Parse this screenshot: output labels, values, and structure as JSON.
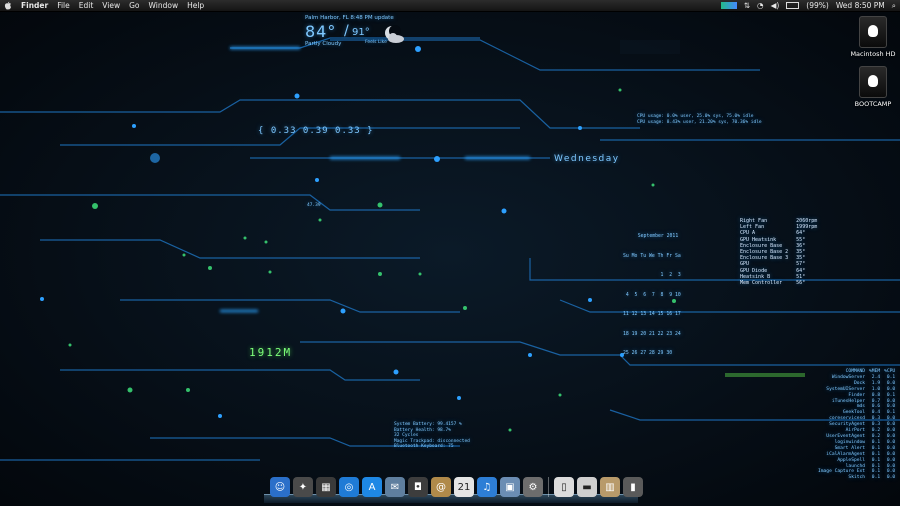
{
  "menubar": {
    "app": "Finder",
    "menus": [
      "File",
      "Edit",
      "View",
      "Go",
      "Window",
      "Help"
    ],
    "battery": "(99%)",
    "clock": "Wed 8:50 PM",
    "icons": [
      "apple-icon",
      "activity-icon",
      "network-icon",
      "wifi-icon",
      "volume-icon",
      "battery-icon",
      "search-icon"
    ]
  },
  "desktop": {
    "drives": [
      {
        "label": "Macintosh HD"
      },
      {
        "label": "BOOTCAMP"
      }
    ]
  },
  "weather": {
    "location": "Palm Harbor, FL 8:48 PM update",
    "temp": "84°",
    "high": "91°",
    "feels": "Feels Like",
    "condition": "Partly Cloudy"
  },
  "load": "{ 0.33 0.39 0.33 }",
  "day": "Wednesday",
  "small_label": "47.39",
  "memory": "1912M",
  "cpu": [
    "CPU usage: 0.0% user, 25.0% sys, 75.0% idle",
    "CPU usage: 8.43% user, 21.20% sys, 70.36% idle"
  ],
  "calendar": {
    "title": "September 2011",
    "lines": [
      "Su Mo Tu We Th Fr Sa",
      "             1  2  3",
      " 4  5  6  7  8  9 10",
      "11 12 13 14 15 16 17",
      "18 19 20 21 22 23 24",
      "25 26 27 28 29 30"
    ]
  },
  "sensors": [
    [
      "Right Fan",
      "2060rpm"
    ],
    [
      "Left Fan",
      "1999rpm"
    ],
    [
      "CPU A",
      "64°"
    ],
    [
      "GPU Heatsink",
      "55°"
    ],
    [
      "Enclosure Base",
      "36°"
    ],
    [
      "Enclosure Base 2",
      "35°"
    ],
    [
      "Enclosure Base 3",
      "35°"
    ],
    [
      "GPU",
      "57°"
    ],
    [
      "GPU Diode",
      "64°"
    ],
    [
      "Heatsink B",
      "51°"
    ],
    [
      "Mem Controller",
      "56°"
    ]
  ],
  "battery": [
    "System Battery: 99.4157 %",
    "Battery Health: 98.7%",
    "32 Cycles",
    "Magic Trackpad: disconnected",
    "Bluetooth Keyboard: 75"
  ],
  "processes": {
    "header": [
      "COMMAND",
      "%MEM",
      "%CPU"
    ],
    "rows": [
      [
        "WindowServer",
        "2.4",
        "0.1"
      ],
      [
        "Dock",
        "1.9",
        "0.0"
      ],
      [
        "SystemUIServer",
        "1.0",
        "0.0"
      ],
      [
        "Finder",
        "0.8",
        "0.1"
      ],
      [
        "iTunesHelper",
        "0.7",
        "0.0"
      ],
      [
        "mds",
        "0.6",
        "0.0"
      ],
      [
        "GeekTool",
        "0.4",
        "0.1"
      ],
      [
        "coreservicesd",
        "0.3",
        "0.0"
      ],
      [
        "SecurityAgent",
        "0.3",
        "0.0"
      ],
      [
        "AirPort",
        "0.2",
        "0.0"
      ],
      [
        "UserEventAgent",
        "0.2",
        "0.0"
      ],
      [
        "loginwindow",
        "0.1",
        "0.0"
      ],
      [
        "Smart Alert",
        "0.1",
        "0.0"
      ],
      [
        "iCalAlarmAgent",
        "0.1",
        "0.0"
      ],
      [
        "AppleSpell",
        "0.1",
        "0.0"
      ],
      [
        "launchd",
        "0.1",
        "0.0"
      ],
      [
        "Image Capture Ext",
        "0.1",
        "0.0"
      ],
      [
        "Skitch",
        "0.1",
        "0.0"
      ]
    ]
  },
  "dock": {
    "items": [
      {
        "name": "finder-icon",
        "glyph": "☺",
        "color": "#2b6fc9"
      },
      {
        "name": "launchpad-icon",
        "glyph": "✦",
        "color": "#4a4a4a"
      },
      {
        "name": "mission-control-icon",
        "glyph": "▦",
        "color": "#3a3a3a"
      },
      {
        "name": "safari-icon",
        "glyph": "◎",
        "color": "#1f7bd6"
      },
      {
        "name": "app-store-icon",
        "glyph": "A",
        "color": "#1e88e5"
      },
      {
        "name": "mail-icon",
        "glyph": "✉",
        "color": "#5f7f9f"
      },
      {
        "name": "facetime-icon",
        "glyph": "◘",
        "color": "#3d3d3d"
      },
      {
        "name": "address-book-icon",
        "glyph": "@",
        "color": "#b08a4a"
      },
      {
        "name": "ical-icon",
        "glyph": "21",
        "color": "#e5e5e5"
      },
      {
        "name": "itunes-icon",
        "glyph": "♫",
        "color": "#2d7ed6"
      },
      {
        "name": "iphoto-icon",
        "glyph": "▣",
        "color": "#6b8db3"
      },
      {
        "name": "system-preferences-icon",
        "glyph": "⚙",
        "color": "#6d6d6d"
      },
      {
        "name": "sep"
      },
      {
        "name": "document-icon",
        "glyph": "▯",
        "color": "#dcdcdc"
      },
      {
        "name": "printer-icon",
        "glyph": "▬",
        "color": "#cfcfcf"
      },
      {
        "name": "package-icon",
        "glyph": "▥",
        "color": "#b89a6a"
      },
      {
        "name": "trash-icon",
        "glyph": "▮",
        "color": "#5a5a5a"
      }
    ]
  }
}
